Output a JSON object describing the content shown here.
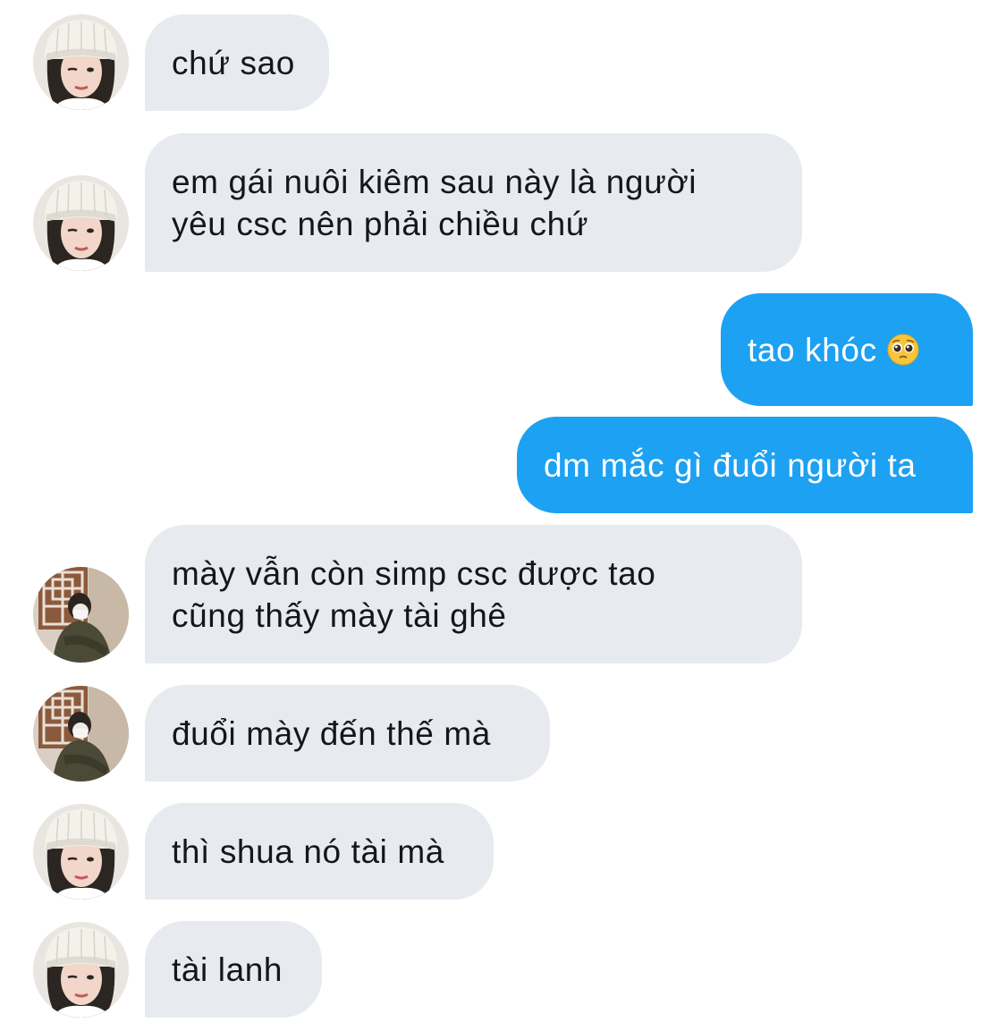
{
  "messages": [
    {
      "text": "chứ sao",
      "sender": "them",
      "avatar": "avatar-white-beanie"
    },
    {
      "text": "em gái nuôi kiêm sau này là người\nyêu csc nên phải chiều chứ",
      "sender": "them",
      "avatar": "avatar-white-beanie"
    },
    {
      "text": "tao khóc",
      "sender": "me",
      "emoji": "pleading-face-emoji"
    },
    {
      "text": "dm mắc gì đuổi người ta",
      "sender": "me"
    },
    {
      "text": "mày vẫn còn simp csc được tao\ncũng thấy mày tài ghê",
      "sender": "them",
      "avatar": "avatar-masked-jacket"
    },
    {
      "text": "đuổi mày đến thế mà",
      "sender": "them",
      "avatar": "avatar-masked-jacket"
    },
    {
      "text": "thì shua nó tài mà",
      "sender": "them",
      "avatar": "avatar-white-beanie"
    },
    {
      "text": "tài lanh",
      "sender": "them",
      "avatar": "avatar-white-beanie"
    }
  ],
  "colors": {
    "received_bubble": "#e7ebef",
    "received_text": "#14171a",
    "sent_bubble": "#1da1f2",
    "sent_text": "#ffffff"
  }
}
